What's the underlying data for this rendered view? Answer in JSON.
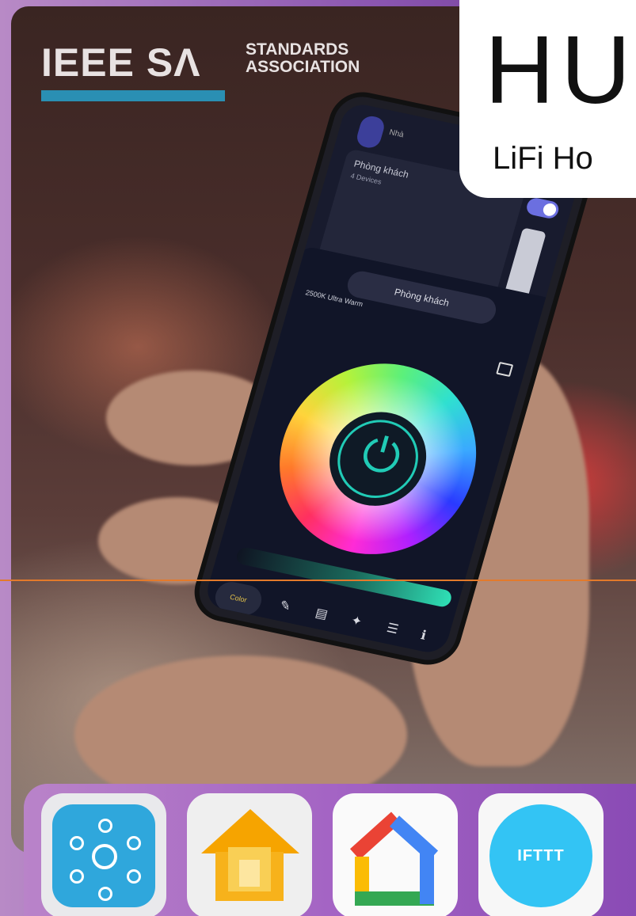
{
  "branding": {
    "logo_main": "IEEE SΛ",
    "logo_sub_line1": "STANDARDS",
    "logo_sub_line2": "ASSOCIATION",
    "logo_bar_color": "#2a8fb3"
  },
  "title_card": {
    "title": "HU",
    "subtitle": "LiFi Ho"
  },
  "phone": {
    "top_label": "Nhà",
    "room_name": "Phòng khách",
    "room_devices": "4 Devices",
    "sheet_title": "Phòng khách",
    "color_temperature": "2500K Ultra Warm",
    "power_icon": "⏻",
    "tab_color_label": "Color",
    "tabs": [
      "✎",
      "▤",
      "✦",
      "☰",
      "ℹ"
    ],
    "nav": [
      "◁",
      "○",
      "□"
    ],
    "accent_color": "#21cbb6"
  },
  "dock": {
    "apps": [
      {
        "name": "SmartThings",
        "icon": "smartthings-icon"
      },
      {
        "name": "Apple Home",
        "icon": "apple-home-icon"
      },
      {
        "name": "Google Home",
        "icon": "google-home-icon"
      },
      {
        "name": "IFTTT",
        "icon": "ifttt-icon",
        "label": "IFTTT"
      }
    ]
  }
}
